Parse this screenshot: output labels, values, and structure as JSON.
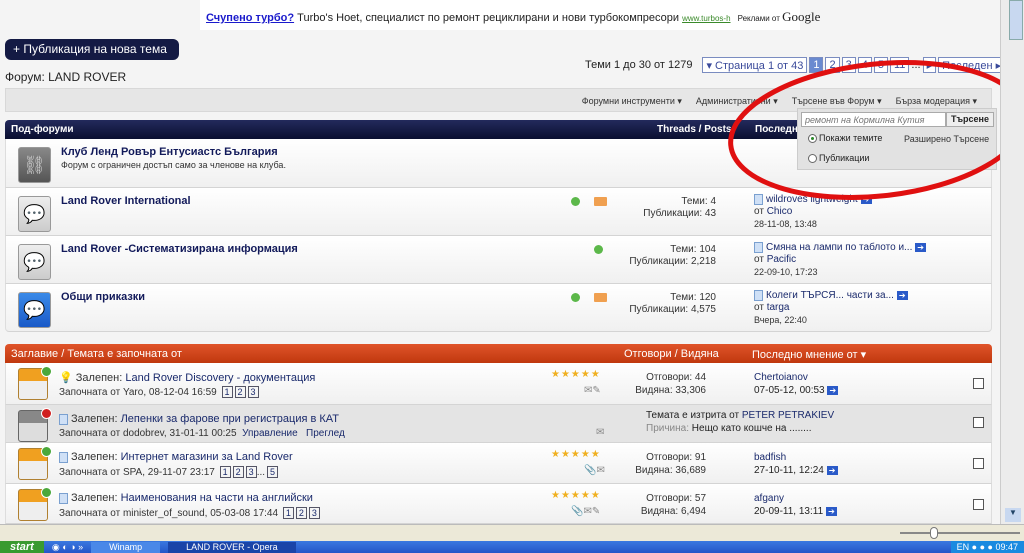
{
  "ad": {
    "headline": "Счупено турбо?",
    "text": "Turbo's Hoet, специалист по ремонт рециклирани и нови турбокомпресори",
    "url": "www.turbos-h",
    "ads_by": "Реклами от",
    "google": "Google"
  },
  "new_thread_label": "+ Публикация на нова тема",
  "forum_title": "Форум: LAND ROVER",
  "pagination": {
    "count": "Теми 1 до 30 от 1279",
    "page_select": "▾ Страница 1 от 43",
    "pages": [
      "1",
      "2",
      "3",
      "4",
      "5",
      "11",
      "..."
    ],
    "next": "▸",
    "last": "Последен ▸▸"
  },
  "toolbar": [
    "Форумни инструменти ▾",
    "Административни ▾",
    "Търсене във Форум ▾",
    "Бърза модерация ▾"
  ],
  "search": {
    "placeholder": "ремонт на Кормилна Кутия",
    "button": "Търсене",
    "opt_threads": "Покажи темите",
    "opt_posts": "Публикации",
    "advanced": "Разширено Търсене"
  },
  "subforums": {
    "header": "Под-форуми",
    "col_stats": "Threads / Posts",
    "col_last": "Последн",
    "items": [
      {
        "title": "Клуб Ленд Ровър Ентусиастс България",
        "desc": "Форум с ограничен достъп само за членове на клуба."
      },
      {
        "title": "Land Rover International",
        "threads": "Теми: 4",
        "posts": "Публикации: 43",
        "last_title": "wildroves lightweight",
        "last_by_pre": "от",
        "last_by": "Chico",
        "last_date": "28-11-08, 13:48"
      },
      {
        "title": "Land Rover -Систематизирана информация",
        "threads": "Теми: 104",
        "posts": "Публикации: 2,218",
        "last_title": "Смяна на лампи по таблото и...",
        "last_by_pre": "от",
        "last_by": "Pacific",
        "last_date": "22-09-10, 17:23"
      },
      {
        "title": "Общи приказки",
        "threads": "Теми: 120",
        "posts": "Публикации: 4,575",
        "last_title": "Колеги ТЪРСЯ... части за...",
        "last_by_pre": "от",
        "last_by": "targa",
        "last_date": "Вчера, 22:40"
      }
    ]
  },
  "threads": {
    "col_title": "Заглавие / Темата е започната от",
    "col_stats": "Отговори / Видяна",
    "col_last": "Последно мнение от ▾",
    "items": [
      {
        "prefix": "Залепен:",
        "title": "Land Rover Discovery - документация",
        "started": "Започната от Yaro, 08-12-04 16:59",
        "pages": [
          "1",
          "2",
          "3"
        ],
        "stars": "★★★★★",
        "replies": "Отговори: 44",
        "views": "Видяна: 33,306",
        "last_by": "Chertoianov",
        "last_date": "07-05-12, 00:53"
      },
      {
        "prefix": "Залепен:",
        "title": "Лепенки за фарове при регистрация в КАТ",
        "started": "Започната от dodobrev, 31-01-11 00:25",
        "manage": "Управление",
        "view": "Преглед",
        "deleted_by": "Темата е изтрита от",
        "deleted_user": "PETER PETRAKIEV",
        "reason_label": "Причина:",
        "reason": "Нещо като кошче на ........"
      },
      {
        "prefix": "Залепен:",
        "title": "Интернет магазини за Land Rover",
        "started": "Започната от SPA, 29-11-07 23:17",
        "pages": [
          "1",
          "2",
          "3",
          "...",
          "5"
        ],
        "stars": "★★★★★",
        "replies": "Отговори: 91",
        "views": "Видяна: 36,689",
        "last_by": "badfish",
        "last_date": "27-10-11, 12:24"
      },
      {
        "prefix": "Залепен:",
        "title": "Наименования на части на английски",
        "started": "Започната от minister_of_sound, 05-03-08 17:44",
        "pages": [
          "1",
          "2",
          "3"
        ],
        "stars": "★★★★★",
        "replies": "Отговори: 57",
        "views": "Видяна: 6,494",
        "last_by": "afgany",
        "last_date": "20-09-11, 13:11"
      }
    ]
  },
  "taskbar": {
    "start": "start",
    "tasks": [
      "Winamp",
      "LAND ROVER - Opera"
    ],
    "clock": "09:47",
    "lang": "EN"
  }
}
